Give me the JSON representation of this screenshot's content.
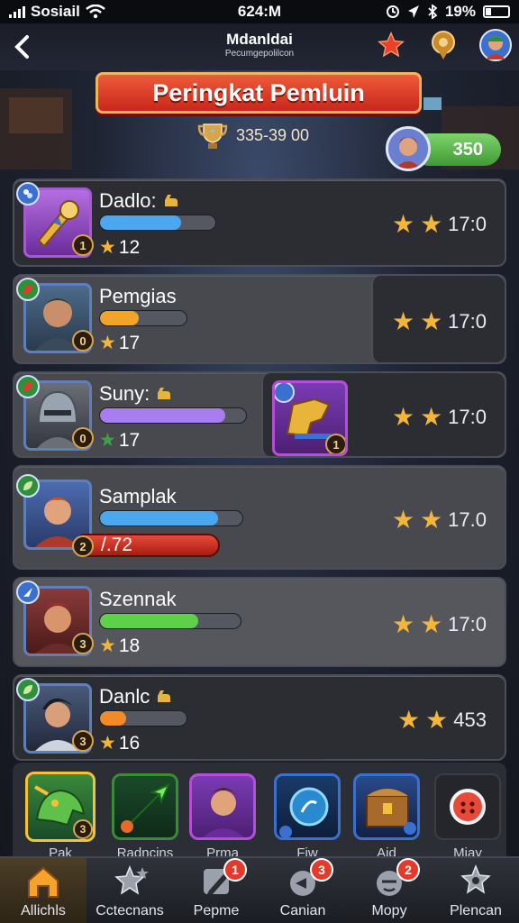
{
  "status_bar": {
    "carrier": "Sosiail",
    "time": "624:M",
    "battery": "19%"
  },
  "header": {
    "title": "Mdanldai",
    "subtitle": "Pecumgepolilcon"
  },
  "banner": {
    "title": "Peringkat Pemluin"
  },
  "score_badge": {
    "value": "335-39 00"
  },
  "player": {
    "points": "350"
  },
  "rows": [
    {
      "name": "Dadlo:",
      "small": "12",
      "score": "17:0",
      "level": "1",
      "progress": 0.7,
      "bar_color": "#4aa8f0"
    },
    {
      "name": "Pemgias",
      "small": "17",
      "score": "17:0",
      "level": "0",
      "progress": 0.45,
      "bar_color": "#f0a52a"
    },
    {
      "name": "Suny:",
      "small": "17",
      "score": "17:0",
      "level": "0",
      "progress": 0.86,
      "bar_color": "#a77df0",
      "reward_level": "1"
    },
    {
      "name": "Samplak",
      "small": "/.72",
      "score": "17.0",
      "level": "2",
      "progress": 0.83,
      "bar_color": "#4aa8f0"
    },
    {
      "name": "Szennak",
      "small": "18",
      "score": "17:0",
      "level": "3",
      "progress": 0.7,
      "bar_color": "#5fd04a"
    },
    {
      "name": "Danlc",
      "small": "16",
      "score": "453",
      "level": "3",
      "progress": 0.3,
      "bar_color": "#f08a2a"
    }
  ],
  "tray": [
    {
      "label": "Pak",
      "icon": "dragon-icon",
      "level": "3"
    },
    {
      "label": "Radncins",
      "icon": "arrow-icon"
    },
    {
      "label": "Prma",
      "icon": "hero-portrait-icon"
    },
    {
      "label": "Fiw",
      "icon": "orb-icon"
    },
    {
      "label": "Aid",
      "icon": "chest-icon"
    },
    {
      "label": "Miay",
      "icon": "button-icon"
    }
  ],
  "nav": [
    {
      "label": "Allichls",
      "icon": "home-icon",
      "badge": ""
    },
    {
      "label": "Cctecnans",
      "icon": "star-group-icon",
      "badge": ""
    },
    {
      "label": "Pepme",
      "icon": "pen-icon",
      "badge": "1"
    },
    {
      "label": "Canian",
      "icon": "horn-icon",
      "badge": "3"
    },
    {
      "label": "Mopy",
      "icon": "emoji-icon",
      "badge": "2"
    },
    {
      "label": "Plencan",
      "icon": "badge-star-icon",
      "badge": ""
    }
  ],
  "colors": {
    "banner": "#d8341f",
    "pill": "#4fae3f",
    "star": "#f3b63a"
  }
}
